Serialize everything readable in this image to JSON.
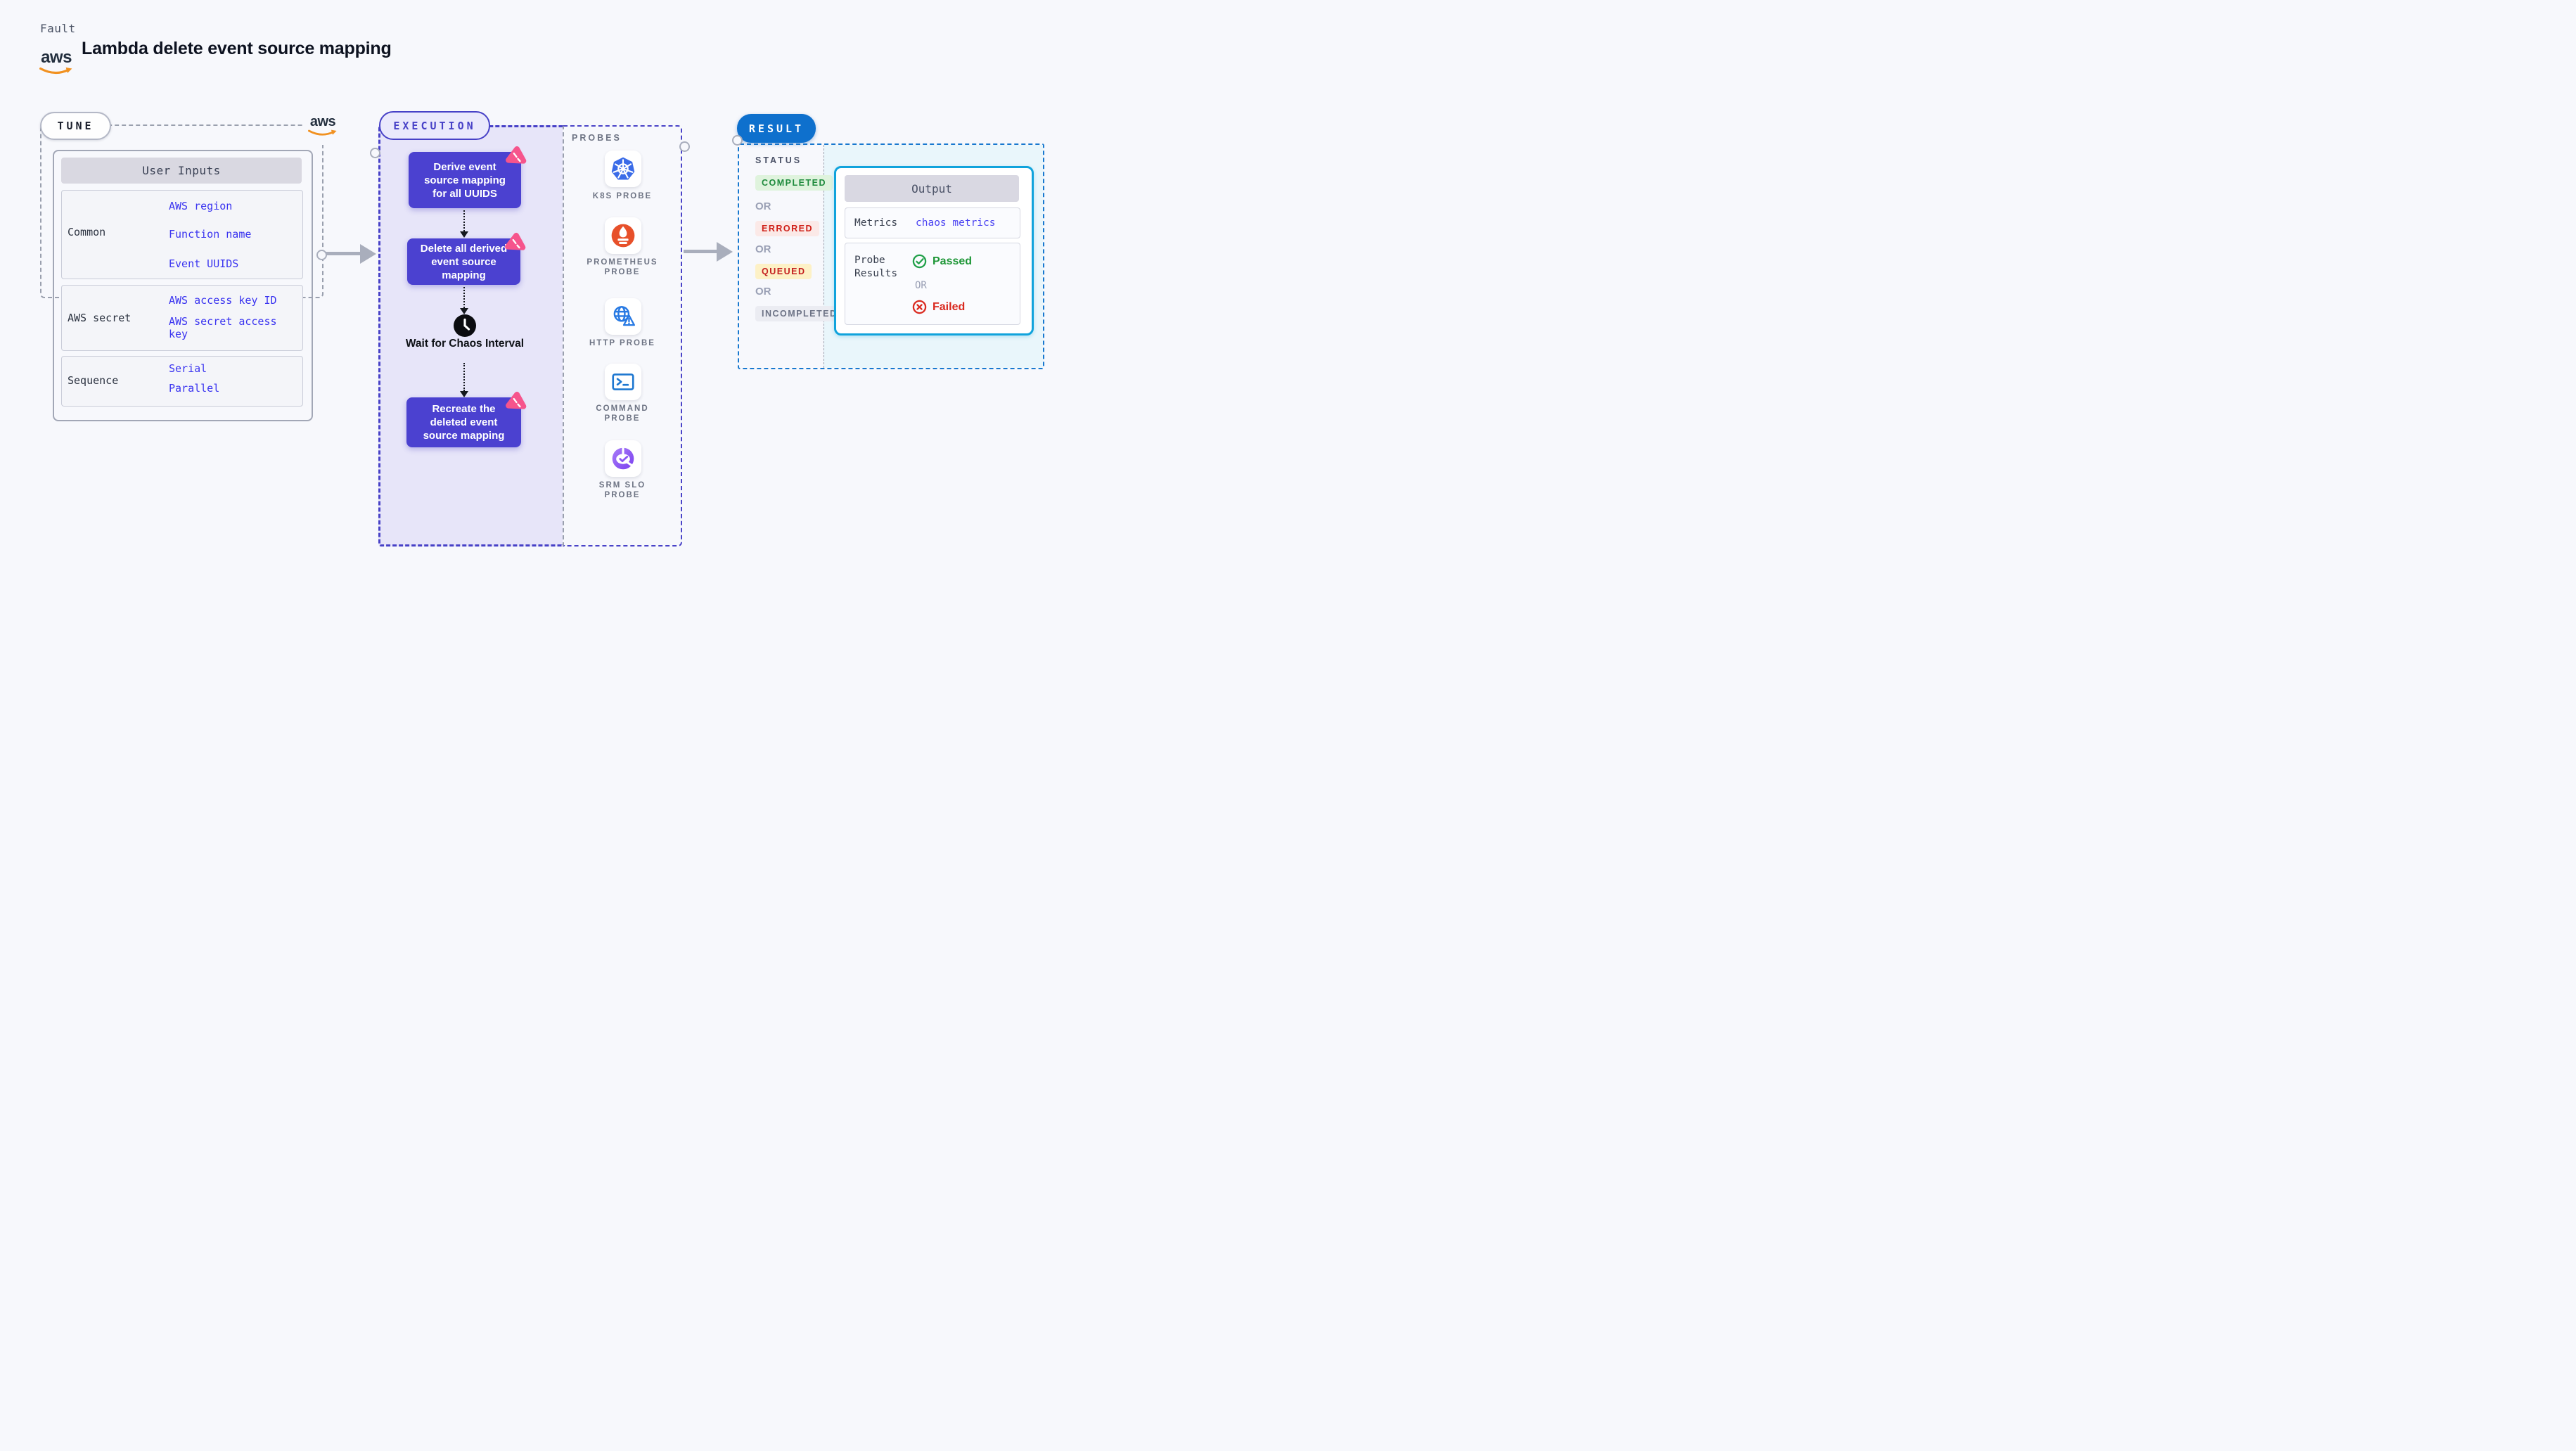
{
  "header": {
    "kicker": "Fault",
    "title": "Lambda delete event source mapping",
    "logo_text": "aws"
  },
  "tune": {
    "pill": "TUNE",
    "table": {
      "header": "User Inputs",
      "rows": [
        {
          "label": "Common",
          "links": [
            "AWS region",
            "Function name",
            "Event UUIDS"
          ]
        },
        {
          "label": "AWS secret",
          "links": [
            "AWS access key ID",
            "AWS secret access key"
          ]
        },
        {
          "label": "Sequence",
          "links": [
            "Serial",
            "Parallel"
          ]
        }
      ]
    }
  },
  "execution": {
    "pill": "EXECUTION",
    "steps": {
      "derive": "Derive event source mapping for all UUIDS",
      "delete": "Delete all derived event source mapping",
      "wait": "Wait for Chaos Interval",
      "recreate": "Recreate the deleted event source mapping"
    }
  },
  "probes": {
    "label": "PROBES",
    "items": [
      {
        "icon": "kubernetes-icon",
        "line1": "K8S PROBE",
        "line2": ""
      },
      {
        "icon": "prometheus-icon",
        "line1": "PROMETHEUS",
        "line2": "PROBE"
      },
      {
        "icon": "http-icon",
        "line1": "HTTP PROBE",
        "line2": ""
      },
      {
        "icon": "command-icon",
        "line1": "COMMAND",
        "line2": "PROBE"
      },
      {
        "icon": "srm-slo-icon",
        "line1": "SRM SLO",
        "line2": "PROBE"
      }
    ]
  },
  "result": {
    "pill": "RESULT",
    "status_label": "STATUS",
    "or_label": "OR",
    "statuses": [
      {
        "label": "COMPLETED",
        "fg": "#1d8a3c",
        "bg": "#dff3dd"
      },
      {
        "label": "ERRORED",
        "fg": "#cf1f17",
        "bg": "#fbe9e7"
      },
      {
        "label": "QUEUED",
        "fg": "#c41f1f",
        "bg": "#fdf1c6"
      },
      {
        "label": "INCOMPLETED",
        "fg": "#6c7285",
        "bg": "#ebecf2"
      }
    ],
    "output": {
      "header": "Output",
      "metrics_label": "Metrics",
      "metrics_value": "chaos metrics",
      "probe_results_label": "Probe Results",
      "passed": "Passed",
      "failed": "Failed"
    }
  },
  "colors": {
    "accent_purple": "#4b41d0",
    "indigo_border": "#4741c7",
    "pink_badge": "#f6548c",
    "result_blue": "#0e70cd",
    "output_border": "#10a3dc",
    "link_blue": "#3a34f0",
    "passed_green": "#1d9636",
    "failed_red": "#d9281e",
    "aws_orange": "#f19120"
  }
}
